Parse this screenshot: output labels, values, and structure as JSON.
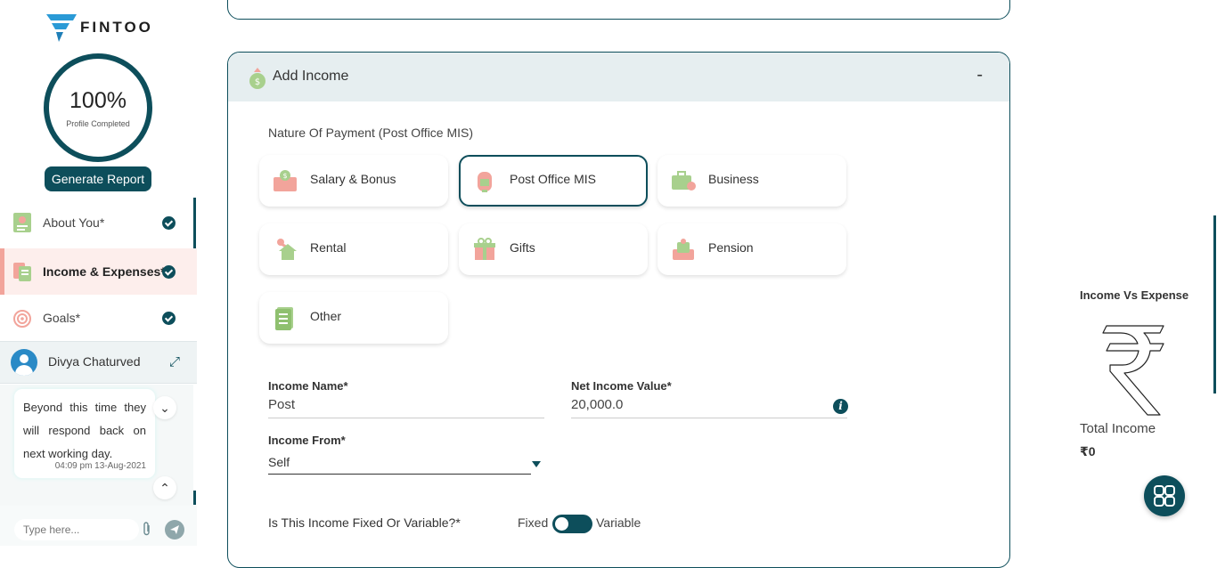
{
  "brand": {
    "name": "FINTOO"
  },
  "profile": {
    "percent": "100%",
    "label": "Profile Completed",
    "generate_report": "Generate Report"
  },
  "nav": {
    "items": [
      {
        "label": "About You*",
        "icon": "about-you-icon"
      },
      {
        "label": "Income & Expenses*",
        "icon": "income-expenses-icon",
        "active": true
      },
      {
        "label": "Goals*",
        "icon": "goals-icon"
      }
    ]
  },
  "chat": {
    "agent_name": "Divya Chaturved",
    "message": "Beyond this time they will respond back on next working day.",
    "timestamp": "04:09 pm 13-Aug-2021",
    "input_placeholder": "Type here..."
  },
  "income_card": {
    "title": "Add Income",
    "collapse": "-",
    "nature_label": "Nature Of Payment (Post Office MIS)",
    "options": [
      {
        "label": "Salary & Bonus",
        "icon": "salary-bonus-icon"
      },
      {
        "label": "Post Office MIS",
        "icon": "post-office-icon",
        "selected": true
      },
      {
        "label": "Business",
        "icon": "business-icon"
      },
      {
        "label": "Rental",
        "icon": "rental-icon"
      },
      {
        "label": "Gifts",
        "icon": "gifts-icon"
      },
      {
        "label": "Pension",
        "icon": "pension-icon"
      },
      {
        "label": "Other",
        "icon": "other-icon"
      }
    ],
    "income_name_label": "Income Name*",
    "income_name_value": "Post",
    "net_income_label": "Net Income Value*",
    "net_income_value": "20,000.0",
    "info_glyph": "i",
    "income_from_label": "Income From*",
    "income_from_value": "Self",
    "fixed_variable_question": "Is This Income Fixed Or Variable?*",
    "fixed_label": "Fixed",
    "variable_label": "Variable",
    "toggle_state": "Fixed"
  },
  "right_panel": {
    "title": "Income Vs Expense",
    "total_income_label": "Total Income",
    "total_income_value": "₹0"
  },
  "colors": {
    "primary": "#0d4e5b",
    "active_bg": "#fdeeec",
    "accent_pink": "#f2a49b",
    "accent_green": "#a8d08d"
  }
}
